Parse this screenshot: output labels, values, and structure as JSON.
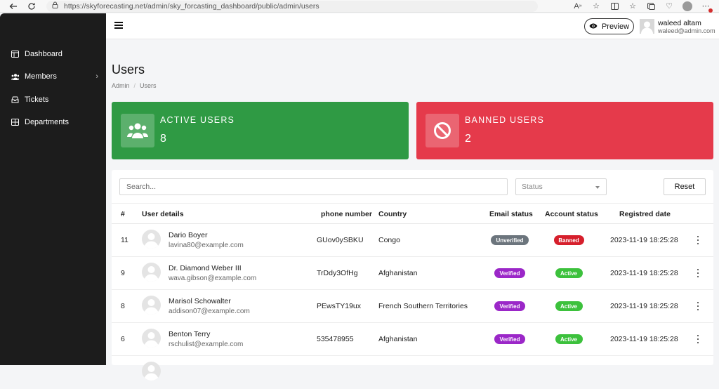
{
  "browser": {
    "url": "https://skyforecasting.net/admin/sky_forcasting_dashboard/public/admin/users"
  },
  "sidebar": {
    "items": [
      {
        "label": "Dashboard",
        "icon": "dashboard-icon"
      },
      {
        "label": "Members",
        "icon": "users-icon",
        "has_submenu": true
      },
      {
        "label": "Tickets",
        "icon": "inbox-icon"
      },
      {
        "label": "Departments",
        "icon": "grid-icon"
      }
    ]
  },
  "header": {
    "preview_label": "Preview",
    "user": {
      "name": "waleed altam",
      "email": "waleed@admin.com"
    }
  },
  "page": {
    "title": "Users",
    "breadcrumb": [
      "Admin",
      "Users"
    ]
  },
  "stats": {
    "active": {
      "label": "ACTIVE USERS",
      "value": "8",
      "color": "#2f9a44"
    },
    "banned": {
      "label": "BANNED USERS",
      "value": "2",
      "color": "#e53a4b"
    }
  },
  "filters": {
    "search_placeholder": "Search...",
    "status_placeholder": "Status",
    "reset_label": "Reset"
  },
  "table": {
    "columns": [
      "#",
      "User details",
      "phone number",
      "Country",
      "Email status",
      "Account status",
      "Registred date"
    ],
    "rows": [
      {
        "id": "11",
        "name": "Dario Boyer",
        "email": "lavina80@example.com",
        "phone": "GUov0ySBKU",
        "country": "Congo",
        "email_status": "Unverified",
        "account_status": "Banned",
        "date": "2023-11-19 18:25:28"
      },
      {
        "id": "9",
        "name": "Dr. Diamond Weber III",
        "email": "wava.gibson@example.com",
        "phone": "TrDdy3OfHg",
        "country": "Afghanistan",
        "email_status": "Verified",
        "account_status": "Active",
        "date": "2023-11-19 18:25:28"
      },
      {
        "id": "8",
        "name": "Marisol Schowalter",
        "email": "addison07@example.com",
        "phone": "PEwsTY19ux",
        "country": "French Southern Territories",
        "email_status": "Verified",
        "account_status": "Active",
        "date": "2023-11-19 18:25:28"
      },
      {
        "id": "6",
        "name": "Benton Terry",
        "email": "rschulist@example.com",
        "phone": "535478955",
        "country": "Afghanistan",
        "email_status": "Verified",
        "account_status": "Active",
        "date": "2023-11-19 18:25:28"
      }
    ]
  },
  "colors": {
    "unverified": "#6c757d",
    "verified": "#9b27c8",
    "banned": "#d61f2c",
    "active": "#3cc13c"
  }
}
